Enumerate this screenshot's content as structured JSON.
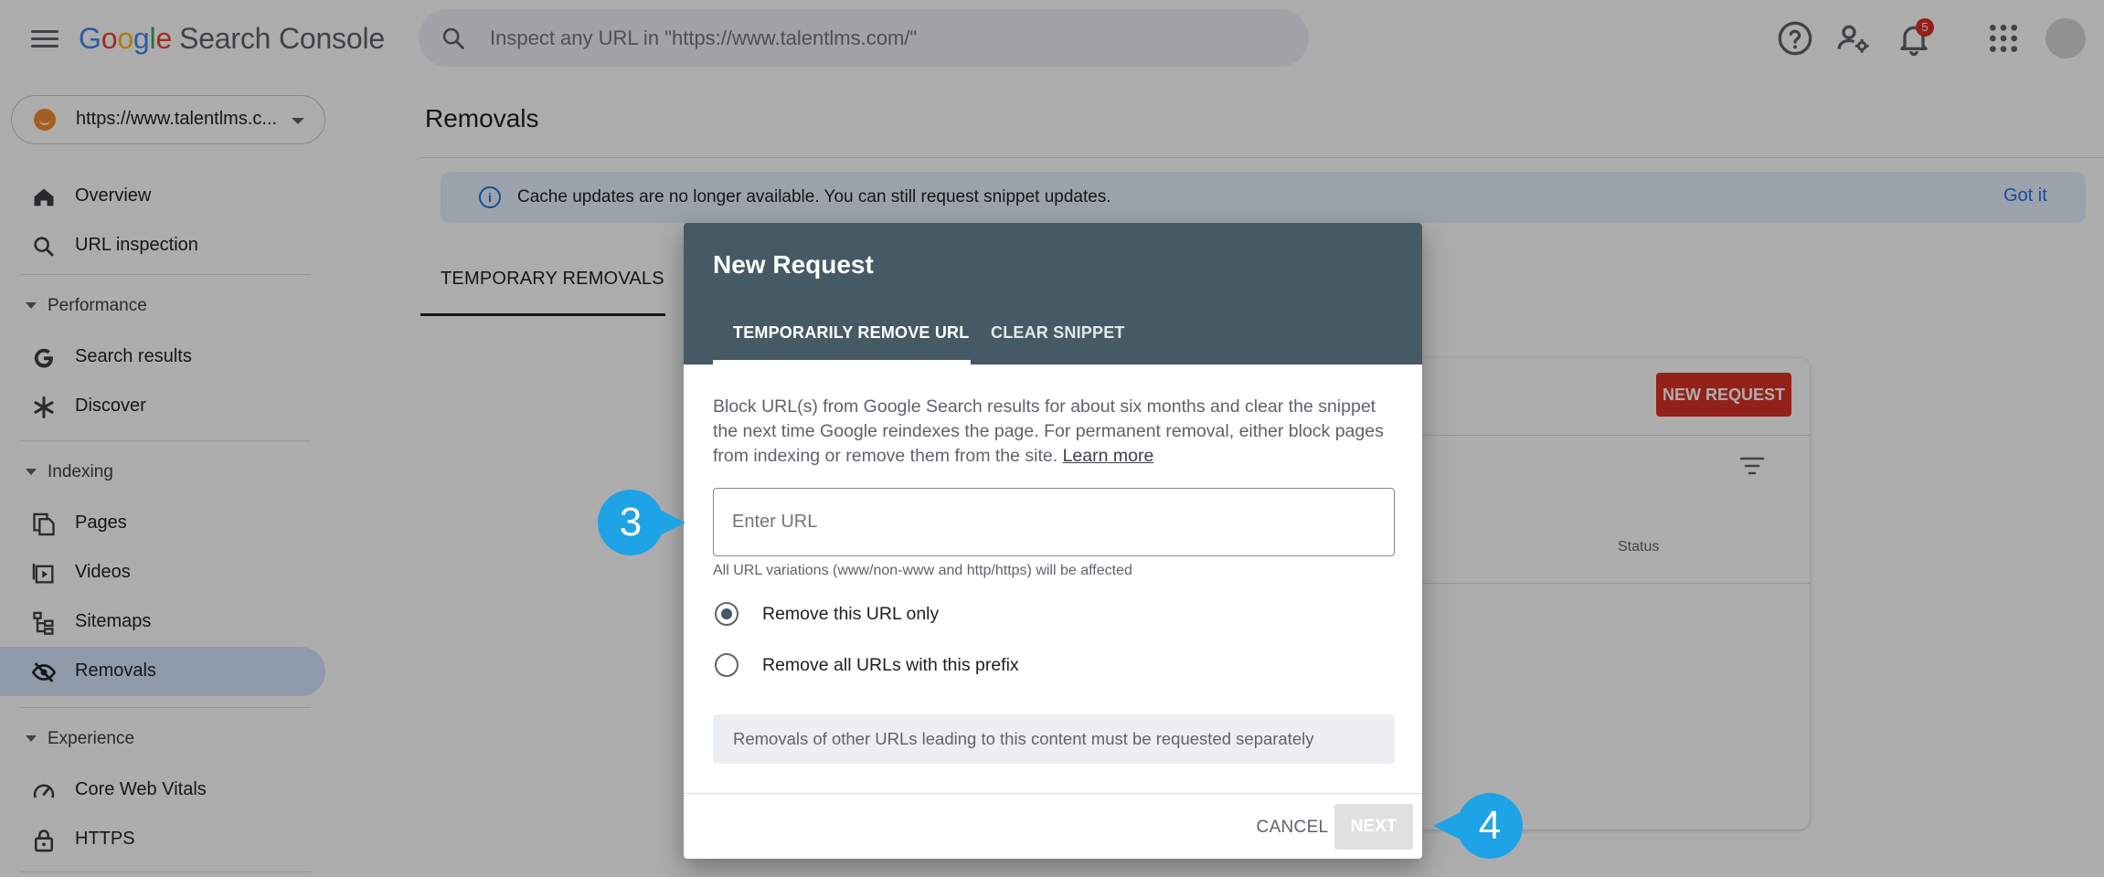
{
  "header": {
    "brand_google": [
      "G",
      "o",
      "o",
      "g",
      "l",
      "e"
    ],
    "brand_product": "Search Console",
    "search_placeholder": "Inspect any URL in \"https://www.talentlms.com/\"",
    "notification_count": "5"
  },
  "sidebar": {
    "property_url": "https://www.talentlms.c...",
    "items": [
      {
        "label": "Overview"
      },
      {
        "label": "URL inspection"
      }
    ],
    "sections": [
      {
        "label": "Performance",
        "items": [
          {
            "label": "Search results"
          },
          {
            "label": "Discover"
          }
        ]
      },
      {
        "label": "Indexing",
        "items": [
          {
            "label": "Pages"
          },
          {
            "label": "Videos"
          },
          {
            "label": "Sitemaps"
          },
          {
            "label": "Removals"
          }
        ]
      },
      {
        "label": "Experience",
        "items": [
          {
            "label": "Core Web Vitals"
          },
          {
            "label": "HTTPS"
          }
        ]
      }
    ],
    "active_item": "Removals"
  },
  "main": {
    "title": "Removals",
    "info_text": "Cache updates are no longer available. You can still request snippet updates.",
    "info_action": "Got it",
    "tab_label": "TEMPORARY REMOVALS",
    "new_request_label": "NEW REQUEST",
    "status_header": "Status"
  },
  "dialog": {
    "title": "New Request",
    "tabs": [
      {
        "label": "TEMPORARILY REMOVE URL"
      },
      {
        "label": "CLEAR SNIPPET"
      }
    ],
    "description": "Block URL(s) from Google Search results for about six months and clear the snippet the next time Google reindexes the page. For permanent removal, either block pages from indexing or remove them from the site.",
    "learn_more": "Learn more",
    "url_placeholder": "Enter URL",
    "url_help": "All URL variations (www/non-www and http/https) will be affected",
    "options": [
      {
        "label": "Remove this URL only",
        "checked": true
      },
      {
        "label": "Remove all URLs with this prefix",
        "checked": false
      }
    ],
    "note": "Removals of other URLs leading to this content must be requested separately",
    "cancel_label": "CANCEL",
    "next_label": "NEXT"
  },
  "callouts": [
    {
      "number": "3"
    },
    {
      "number": "4"
    }
  ],
  "colors": {
    "dialog_header": "#455a64",
    "active_nav": "#d3e3fd",
    "new_request": "#d93025",
    "callout": "#1ea3e6",
    "info_bar": "#e8f0fe"
  }
}
